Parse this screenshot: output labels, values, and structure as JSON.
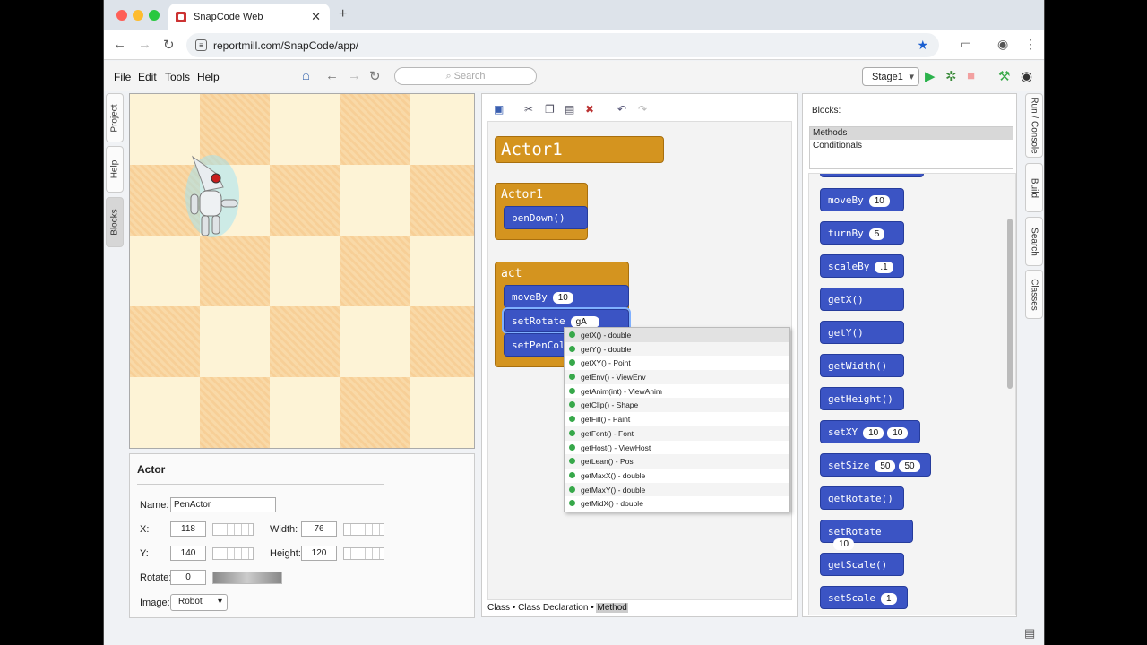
{
  "browser": {
    "tab_title": "SnapCode Web",
    "url": "reportmill.com/SnapCode/app/"
  },
  "menu": [
    "File",
    "Edit",
    "Tools",
    "Help"
  ],
  "search_placeholder": "Search",
  "stage_select": "Stage1",
  "left_tabs": [
    "Project",
    "Help",
    "Blocks"
  ],
  "right_tabs": [
    "Run / Console",
    "Build",
    "Search",
    "Classes"
  ],
  "props": {
    "title": "Actor",
    "name_label": "Name:",
    "name_value": "PenActor",
    "x_label": "X:",
    "x_value": "118",
    "y_label": "Y:",
    "y_value": "140",
    "width_label": "Width:",
    "width_value": "76",
    "height_label": "Height:",
    "height_value": "120",
    "rotate_label": "Rotate:",
    "rotate_value": "0",
    "image_label": "Image:",
    "image_value": "Robot"
  },
  "editor": {
    "class_block": "Actor1",
    "ctor_block": "Actor1",
    "ctor_stmt": "penDown()",
    "act_block": "act",
    "act_stmts": [
      {
        "name": "moveBy",
        "arg": "10"
      },
      {
        "name": "setRotate",
        "arg": "gA"
      },
      {
        "name": "setPenColo"
      }
    ],
    "footer": {
      "p1": "Class • Class Declaration • ",
      "p2": "Method"
    }
  },
  "autocomplete": [
    "getX() - double",
    "getY() - double",
    "getXY() - Point",
    "getEnv() - ViewEnv",
    "getAnim(int) - ViewAnim",
    "getClip() - Shape",
    "getFill() - Paint",
    "getFont() - Font",
    "getHost() - ViewHost",
    "getLean() - Pos",
    "getMaxX() - double",
    "getMaxY() - double",
    "getMidX() - double"
  ],
  "blocks_panel": {
    "header": "Blocks:",
    "categories": [
      "Methods",
      "Conditionals"
    ],
    "items": [
      {
        "name": "moveBy",
        "args": [
          "10"
        ]
      },
      {
        "name": "turnBy",
        "args": [
          "5"
        ]
      },
      {
        "name": "scaleBy",
        "args": [
          ".1"
        ]
      },
      {
        "name": "getX()",
        "args": []
      },
      {
        "name": "getY()",
        "args": []
      },
      {
        "name": "getWidth()",
        "args": []
      },
      {
        "name": "getHeight()",
        "args": []
      },
      {
        "name": "setXY",
        "args": [
          "10",
          "10"
        ]
      },
      {
        "name": "setSize",
        "args": [
          "50",
          "50"
        ]
      },
      {
        "name": "getRotate()",
        "args": []
      },
      {
        "name": "setRotate",
        "args": [
          "10"
        ]
      },
      {
        "name": "getScale()",
        "args": []
      },
      {
        "name": "setScale",
        "args": [
          "1"
        ]
      }
    ]
  }
}
